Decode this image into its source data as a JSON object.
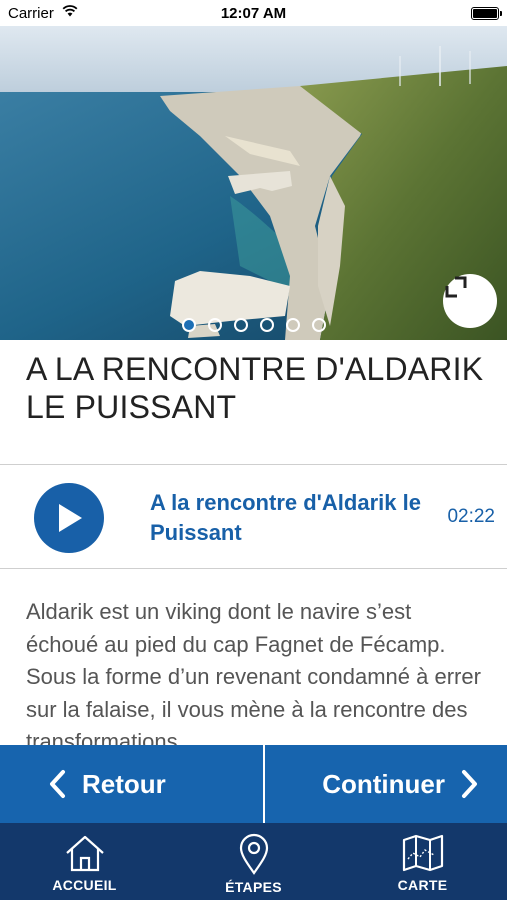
{
  "status_bar": {
    "carrier": "Carrier",
    "time": "12:07 AM"
  },
  "hero": {
    "slides_total": 6,
    "active_slide": 1,
    "expand_icon": "expand-icon"
  },
  "title": "A LA RENCONTRE D'ALDARIK LE PUISSANT",
  "audio": {
    "track_title": "A la rencontre d'Aldarik le Puissant",
    "duration": "02:22",
    "play_icon": "play-icon"
  },
  "description": "Aldarik est un viking dont le navire s’est échoué au pied du cap Fagnet de Fécamp. Sous la forme d’un revenant condamné à errer sur la falaise, il vous mène à la rencontre des transformations",
  "nav": {
    "back_label": "Retour",
    "next_label": "Continuer"
  },
  "tabs": [
    {
      "label": "ACCUEIL",
      "icon": "home-icon"
    },
    {
      "label": "ÉTAPES",
      "icon": "map-pin-icon"
    },
    {
      "label": "CARTE",
      "icon": "map-icon"
    }
  ],
  "colors": {
    "primary_blue": "#1764ae",
    "tab_bar": "#13386b",
    "accent_text": "#1860a8"
  }
}
